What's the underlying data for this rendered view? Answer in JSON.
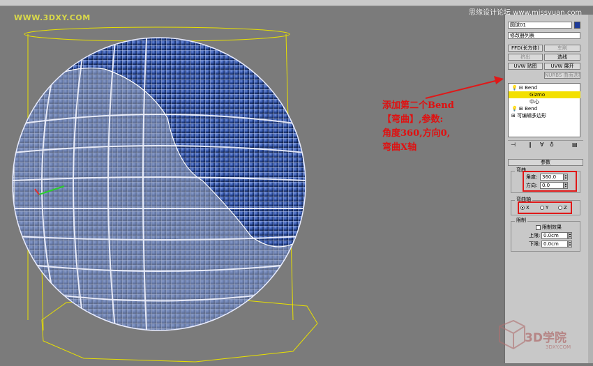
{
  "watermark_top": "WWW.3DXY.COM",
  "credit": "思缘设计论坛 www.missyuan.com",
  "annotation": [
    "添加第二个Bend",
    "【弯曲】,参数:",
    "角度360,方向0,",
    "弯曲X轴"
  ],
  "panel": {
    "object_name": "圆球01",
    "modifier_list": "修改器列表",
    "buttons": {
      "ffd": "FFD(长方体)",
      "lathe": "车削",
      "extrude": "挤出",
      "edge": "选线",
      "uvw_map": "UVW 贴图",
      "uvw_unwrap": "UVW 展开",
      "nurbs": "NURBS 曲面选择"
    },
    "stack": [
      {
        "label": "Bend",
        "prefix": "⊟"
      },
      {
        "label": "Gizmo",
        "prefix": ""
      },
      {
        "label": "中心",
        "prefix": ""
      },
      {
        "label": "Bend",
        "prefix": "⊞"
      },
      {
        "label": "可编辑多边形",
        "prefix": "⊞"
      }
    ],
    "params_title": "参数",
    "bend_group": "弯曲",
    "angle_label": "角度:",
    "angle_value": "360.0",
    "direction_label": "方向:",
    "direction_value": "0.0",
    "axis_group": "弯曲轴",
    "axis_x": "X",
    "axis_y": "Y",
    "axis_z": "Z",
    "limit_group": "限制",
    "limit_effect": "限制效果",
    "upper_label": "上限:",
    "upper_value": "0.0cm",
    "lower_label": "下限:",
    "lower_value": "0.0cm"
  },
  "logo": {
    "text": "3D学院",
    "sub": "3DXY.COM"
  },
  "colors": {
    "highlight": "#e01818",
    "selection": "#f3e000",
    "gizmo": "#e8e000",
    "globe": "#2a4a9a"
  }
}
